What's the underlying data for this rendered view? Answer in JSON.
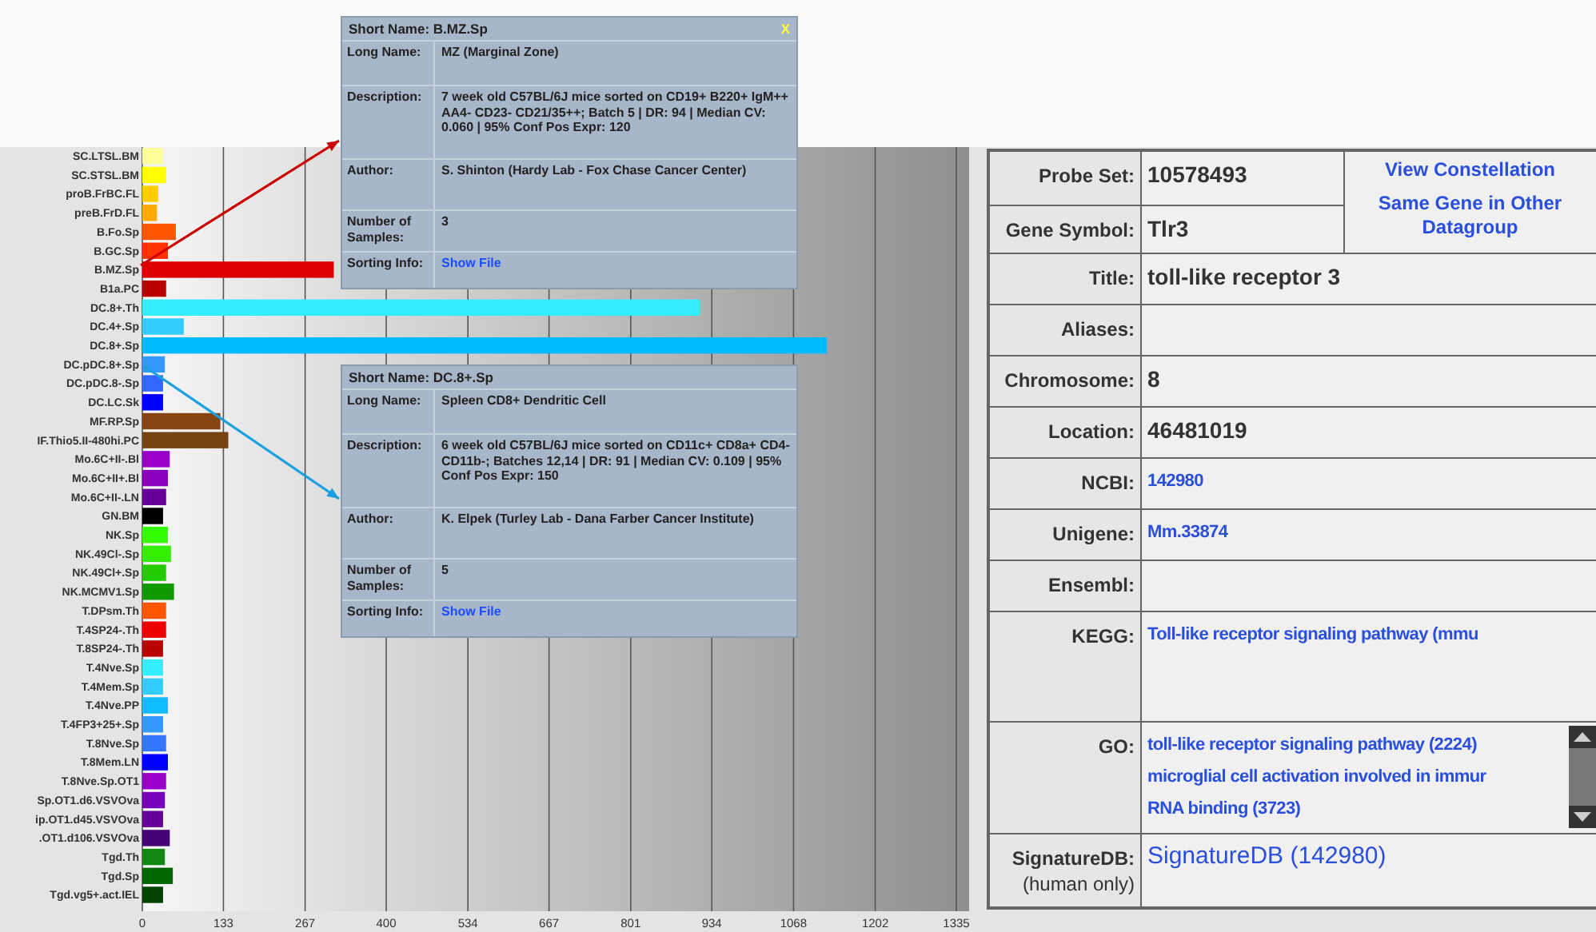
{
  "chart": {
    "chart_data": {
      "type": "bar",
      "orientation": "horizontal",
      "categories": [
        "SC.LTSL.BM",
        "SC.STSL.BM",
        "proB.FrBC.FL",
        "preB.FrD.FL",
        "B.Fo.Sp",
        "B.GC.Sp",
        "B.MZ.Sp",
        "B1a.PC",
        "DC.8+.Th",
        "DC.4+.Sp",
        "DC.8+.Sp",
        "DC.pDC.8+.Sp",
        "DC.pDC.8-.Sp",
        "DC.LC.Sk",
        "MF.RP.Sp",
        "IF.Thio5.II-480hi.PC",
        "Mo.6C+II-.Bl",
        "Mo.6C+II+.Bl",
        "Mo.6C+II-.LN",
        "GN.BM",
        "NK.Sp",
        "NK.49Cl-.Sp",
        "NK.49Cl+.Sp",
        "NK.MCMV1.Sp",
        "T.DPsm.Th",
        "T.4SP24-.Th",
        "T.8SP24-.Th",
        "T.4Nve.Sp",
        "T.4Mem.Sp",
        "T.4Nve.PP",
        "T.4FP3+25+.Sp",
        "T.8Nve.Sp",
        "T.8Mem.LN",
        "T.8Nve.Sp.OT1",
        "Sp.OT1.d6.VSVOva",
        "ip.OT1.d45.VSVOva",
        ".OT1.d106.VSVOva",
        "Tgd.Th",
        "Tgd.Sp",
        "Tgd.vg5+.act.IEL"
      ],
      "series": [
        {
          "values": [
            34,
            39,
            26,
            24,
            55,
            42,
            314,
            39,
            914,
            68,
            1123,
            37,
            34,
            34,
            128,
            141,
            45,
            42,
            39,
            34,
            42,
            47,
            39,
            52,
            39,
            39,
            34,
            34,
            34,
            42,
            34,
            39,
            42,
            39,
            37,
            34,
            45,
            37,
            50,
            34
          ]
        }
      ],
      "grid": true,
      "xlim": [
        0,
        1335
      ],
      "xticks": [
        0,
        133,
        267,
        400,
        534,
        667,
        801,
        934,
        1068,
        1202,
        1335
      ]
    }
  },
  "popups": [
    {
      "short_name_label": "Short Name:",
      "short_name": "B.MZ.Sp",
      "close": "X",
      "color": "#cc0000",
      "rows": [
        {
          "label": "Long Name:",
          "value": "MZ (Marginal Zone)",
          "kind": "text"
        },
        {
          "label": "Description:",
          "value": "7 week old C57BL/6J mice sorted on CD19+ B220+ IgM++ AA4- CD23- CD21/35++; Batch 5 | DR: 94 | Median CV: 0.060 | 95% Conf Pos Expr: 120",
          "kind": "text"
        },
        {
          "label": "Author:",
          "value": "S. Shinton (Hardy Lab - Fox Chase Cancer Center)",
          "kind": "text"
        },
        {
          "label": "Number of Samples:",
          "value": "3",
          "kind": "text"
        },
        {
          "label": "Sorting Info:",
          "value": "Show File",
          "kind": "link"
        }
      ]
    },
    {
      "short_name_label": "Short Name:",
      "short_name": "DC.8+.Sp",
      "color": "#1aa0e0",
      "rows": [
        {
          "label": "Long Name:",
          "value": "Spleen CD8+ Dendritic Cell",
          "kind": "text"
        },
        {
          "label": "Description:",
          "value": "6 week old C57BL/6J mice sorted on CD11c+ CD8a+ CD4- CD11b-; Batches 12,14 | DR: 91 | Median CV: 0.109 | 95% Conf Pos Expr: 150",
          "kind": "text"
        },
        {
          "label": "Author:",
          "value": "K. Elpek (Turley Lab - Dana Farber Cancer Institute)",
          "kind": "text"
        },
        {
          "label": "Number of Samples:",
          "value": "5",
          "kind": "text"
        },
        {
          "label": "Sorting Info:",
          "value": "Show File",
          "kind": "link"
        }
      ]
    }
  ],
  "gene_info": {
    "links": [
      "View Constellation",
      "Same Gene in Other Datagroup"
    ],
    "rows": [
      {
        "label": "Probe Set:",
        "values": [
          {
            "text": "10578493",
            "kind": "text"
          }
        ]
      },
      {
        "label": "Gene Symbol:",
        "values": [
          {
            "text": "Tlr3",
            "kind": "text"
          }
        ]
      },
      {
        "label": "Title:",
        "values": [
          {
            "text": "toll-like receptor 3",
            "kind": "text"
          }
        ]
      },
      {
        "label": "Aliases:",
        "values": []
      },
      {
        "label": "Chromosome:",
        "values": [
          {
            "text": "8",
            "kind": "text"
          }
        ]
      },
      {
        "label": "Location:",
        "values": [
          {
            "text": "46481019",
            "kind": "text"
          }
        ]
      },
      {
        "label": "NCBI:",
        "values": [
          {
            "text": "142980",
            "kind": "link"
          }
        ]
      },
      {
        "label": "Unigene:",
        "values": [
          {
            "text": "Mm.33874",
            "kind": "link"
          }
        ]
      },
      {
        "label": "Ensembl:",
        "values": []
      },
      {
        "label": "KEGG:",
        "values": [
          {
            "text": "Toll-like receptor signaling pathway (mmu",
            "kind": "link"
          }
        ]
      },
      {
        "label": "GO:",
        "scroll": true,
        "values": [
          {
            "text": "toll-like receptor signaling pathway (2224)",
            "kind": "link"
          },
          {
            "text": "microglial cell activation involved in immur",
            "kind": "link"
          },
          {
            "text": "RNA binding (3723)",
            "kind": "link"
          }
        ]
      },
      {
        "label": "SignatureDB:",
        "note": "(human only)",
        "values": [
          {
            "text": "SignatureDB (142980)",
            "kind": "biglink"
          }
        ]
      }
    ]
  }
}
